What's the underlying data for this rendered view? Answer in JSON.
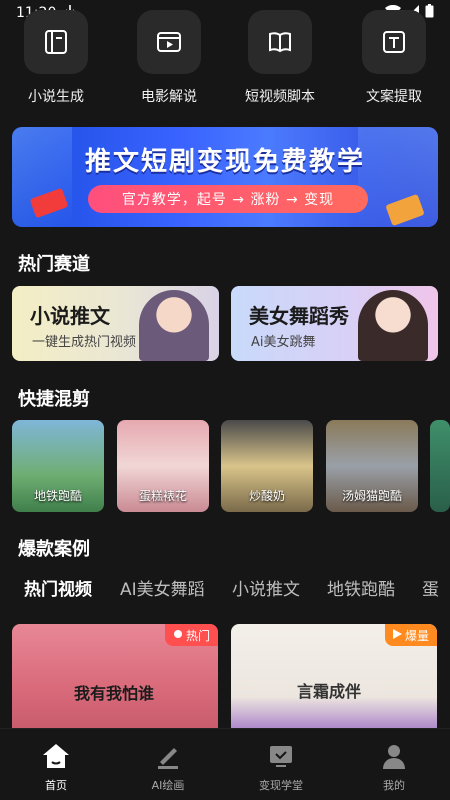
{
  "status": {
    "time": "11:20"
  },
  "tools": [
    {
      "label": "小说生成",
      "icon": "book-icon"
    },
    {
      "label": "电影解说",
      "icon": "video-icon"
    },
    {
      "label": "短视频脚本",
      "icon": "open-book-icon"
    },
    {
      "label": "文案提取",
      "icon": "text-icon"
    }
  ],
  "banner": {
    "title": "推文短剧变现免费教学",
    "subtitle": "官方教学，起号 → 涨粉 → 变现"
  },
  "hot_section": {
    "title": "热门赛道",
    "cards": [
      {
        "title": "小说推文",
        "subtitle": "一键生成热门视频"
      },
      {
        "title": "美女舞蹈秀",
        "subtitle": "Ai美女跳舞"
      }
    ]
  },
  "mix_section": {
    "title": "快捷混剪",
    "items": [
      {
        "label": "地铁跑酷"
      },
      {
        "label": "蛋糕裱花"
      },
      {
        "label": "炒酸奶"
      },
      {
        "label": "汤姆猫跑酷"
      }
    ]
  },
  "cases_section": {
    "title": "爆款案例",
    "tabs": [
      "热门视频",
      "AI美女舞蹈",
      "小说推文",
      "地铁跑酷",
      "蛋"
    ],
    "cards": [
      {
        "badge": "热门",
        "caption": "我有我怕谁"
      },
      {
        "badge": "爆量",
        "caption": "言霜成伴"
      }
    ]
  },
  "bottom_nav": [
    {
      "label": "首页",
      "icon": "home-icon"
    },
    {
      "label": "AI绘画",
      "icon": "paint-icon"
    },
    {
      "label": "变现学堂",
      "icon": "classroom-icon"
    },
    {
      "label": "我的",
      "icon": "profile-icon"
    }
  ],
  "colors": {
    "background": "#161616",
    "banner": "#3a63ff",
    "badge": "#ff4f4f",
    "badge_alt": "#ff8a1f"
  }
}
